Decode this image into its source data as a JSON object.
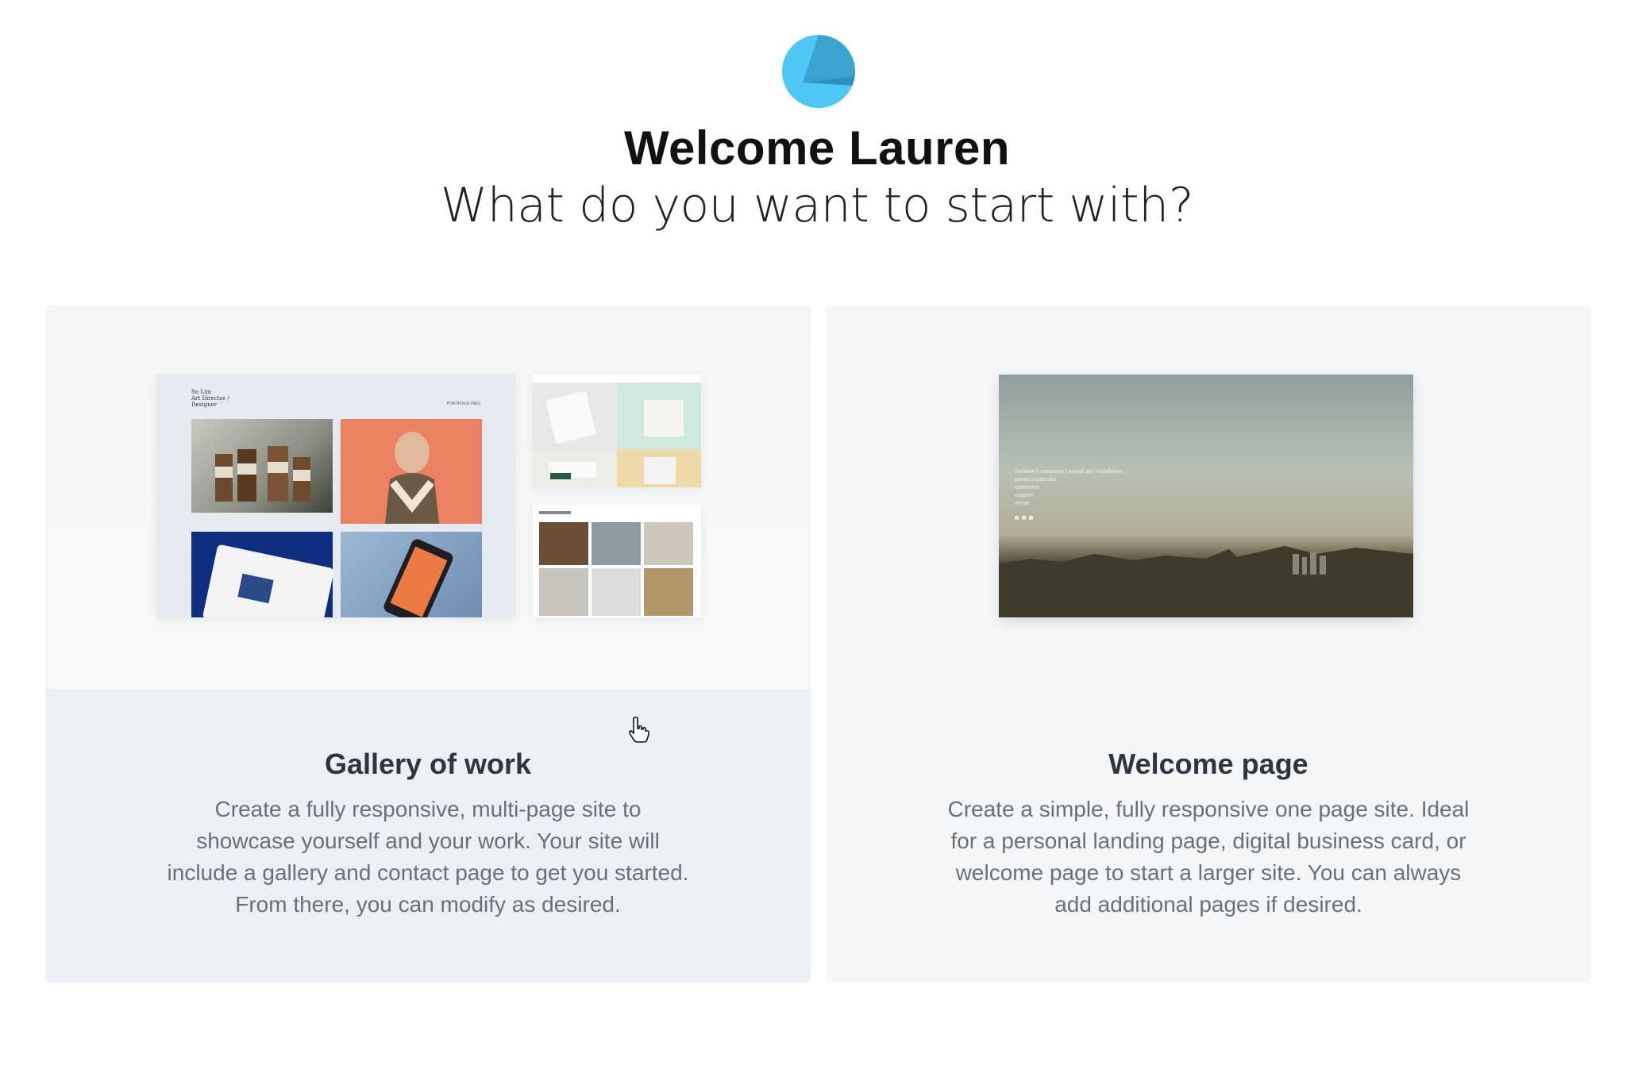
{
  "header": {
    "logo_icon": "portfolio-logo-icon",
    "title": "Welcome Lauren",
    "subtitle": "What do you want to start with?"
  },
  "cards": [
    {
      "title": "Gallery of work",
      "description": "Create a fully responsive, multi-page site to showcase yourself and your work. Your site will include a gallery and contact page to get you started. From there, you can modify as desired.",
      "preview": {
        "name": "Su Lim\nArt Director /\nDesigner",
        "nav": "PORTFOLIO   INFO"
      },
      "state": "hovered"
    },
    {
      "title": "Welcome page",
      "description": "Create a simple, fully responsive one page site. Ideal for a personal landing page, digital business card, or welcome page to start a larger site. You can always add additional pages if desired.",
      "preview": {
        "text": "Ambient | composer | sound art | installation\npoetic universals\nstatement\nsupport\nmusic"
      }
    }
  ],
  "colors": {
    "accent": "#4fc7f5",
    "card_hover_bg": "#eceff3",
    "card_bg": "#f5f6f8"
  },
  "cursor_icon": "hand-pointer-icon"
}
